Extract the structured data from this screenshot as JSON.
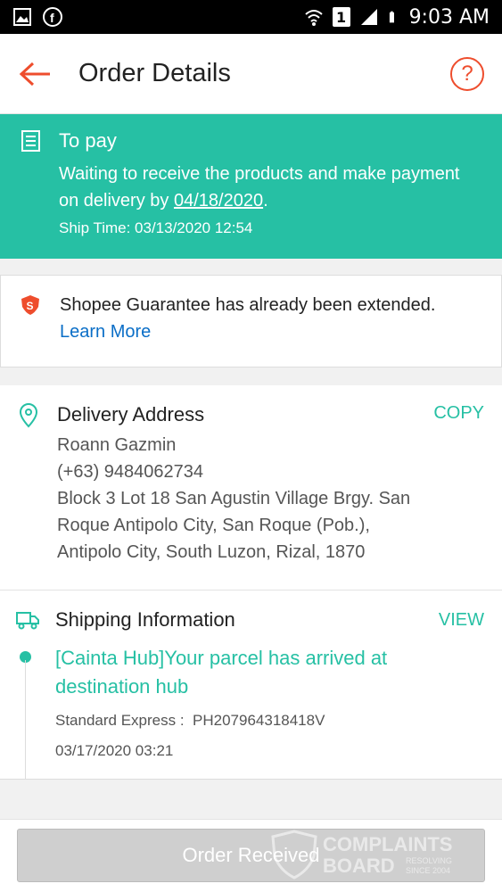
{
  "status_bar": {
    "time": "9:03 AM",
    "sim_label": "1",
    "icons": [
      "gallery-icon",
      "facebook-icon",
      "wifi-icon",
      "signal-icon",
      "battery-icon"
    ]
  },
  "header": {
    "title": "Order Details"
  },
  "status": {
    "title": "To pay",
    "message_prefix": "Waiting to receive the products and make payment on delivery by ",
    "date": "04/18/2020",
    "message_suffix": ".",
    "ship_time": "Ship Time: 03/13/2020 12:54",
    "color": "#26c0a4"
  },
  "guarantee": {
    "text": "Shopee Guarantee has already been extended.",
    "link": "Learn More"
  },
  "delivery": {
    "title": "Delivery Address",
    "action": "COPY",
    "name": "Roann Gazmin",
    "phone": "(+63) 9484062734",
    "address_line1": "Block 3 Lot 18 San Agustin Village Brgy. San",
    "address_line2": "Roque Antipolo City, San Roque (Pob.),",
    "address_line3": "Antipolo City, South Luzon, Rizal, 1870"
  },
  "shipping": {
    "title": "Shipping Information",
    "action": "VIEW",
    "status_line1": "[Cainta Hub]Your parcel has arrived at",
    "status_line2": "destination hub",
    "carrier": "Standard Express :  PH207964318418V",
    "date": "03/17/2020 03:21"
  },
  "footer": {
    "button": "Order Received"
  },
  "watermark": {
    "line1": "COMPLAINTS",
    "line2": "BOARD",
    "tag1": "RESOLVING",
    "tag2": "SINCE 2004"
  },
  "colors": {
    "accent": "#ee4d2d",
    "teal": "#26c0a4",
    "link": "#0a6ec7"
  }
}
